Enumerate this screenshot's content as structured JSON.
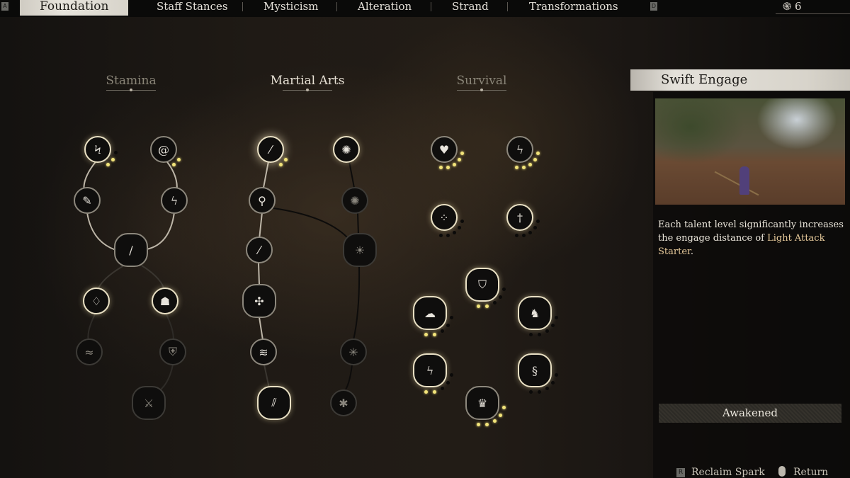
{
  "header": {
    "prev_key": "A",
    "next_key": "D",
    "tabs": [
      {
        "label": "Foundation",
        "active": true
      },
      {
        "label": "Staff Stances",
        "active": false
      },
      {
        "label": "Mysticism",
        "active": false
      },
      {
        "label": "Alteration",
        "active": false
      },
      {
        "label": "Strand",
        "active": false
      },
      {
        "label": "Transformations",
        "active": false
      }
    ],
    "sparks_icon": "spark-swirl-icon",
    "sparks_count": "6"
  },
  "columns": [
    {
      "title": "Stamina",
      "selected": false
    },
    {
      "title": "Martial Arts",
      "selected": true
    },
    {
      "title": "Survival",
      "selected": false
    }
  ],
  "nodes": {
    "stamina": [
      {
        "icon": "dash-icon",
        "glyph": "Ϟ",
        "state": "lit",
        "level": 2,
        "max": 3
      },
      {
        "icon": "swirl-icon",
        "glyph": "@",
        "state": "normal",
        "level": 2,
        "max": 2
      },
      {
        "icon": "scroll-icon",
        "glyph": "✎",
        "state": "normal"
      },
      {
        "icon": "wind-icon",
        "glyph": "ϟ",
        "state": "normal"
      },
      {
        "icon": "staff-swirl-icon",
        "glyph": "∕",
        "state": "normal",
        "major": true
      },
      {
        "icon": "droplet-icon",
        "glyph": "♢",
        "state": "lit"
      },
      {
        "icon": "guard-figure-icon",
        "glyph": "☗",
        "state": "lit"
      },
      {
        "icon": "dragon-icon",
        "glyph": "≈",
        "state": "dark"
      },
      {
        "icon": "shield-figure-icon",
        "glyph": "⛨",
        "state": "dark"
      },
      {
        "icon": "fighter-icon",
        "glyph": "⚔",
        "state": "dark",
        "major": true
      }
    ],
    "martial_arts": [
      {
        "icon": "staff-strike-icon",
        "glyph": "⁄",
        "state": "lit",
        "level": 2,
        "max": 2,
        "selected": true
      },
      {
        "icon": "burst-icon",
        "glyph": "✺",
        "state": "lit"
      },
      {
        "icon": "staff-spin-icon",
        "glyph": "⚲",
        "state": "normal"
      },
      {
        "icon": "burst-dim-icon",
        "glyph": "✺",
        "state": "dark"
      },
      {
        "icon": "thrust-icon",
        "glyph": "⁄",
        "state": "normal"
      },
      {
        "icon": "eye-sun-icon",
        "glyph": "☀",
        "state": "dark",
        "major": true
      },
      {
        "icon": "shuriken-icon",
        "glyph": "✣",
        "state": "normal",
        "major": true
      },
      {
        "icon": "claws-icon",
        "glyph": "≋",
        "state": "normal"
      },
      {
        "icon": "spark-dim-icon",
        "glyph": "✳",
        "state": "dark"
      },
      {
        "icon": "staves-icon",
        "glyph": "⫽",
        "state": "lit",
        "major": true
      },
      {
        "icon": "web-icon",
        "glyph": "✱",
        "state": "dark"
      }
    ],
    "survival": [
      {
        "icon": "heart-icon",
        "glyph": "♥",
        "state": "normal",
        "level": 5,
        "max": 5
      },
      {
        "icon": "lightning-icon",
        "glyph": "ϟ",
        "state": "normal",
        "level": 5,
        "max": 5
      },
      {
        "icon": "four-swirls-icon",
        "glyph": "⁘",
        "state": "lit",
        "level": 0,
        "max": 5
      },
      {
        "icon": "blade-icon",
        "glyph": "†",
        "state": "lit",
        "level": 0,
        "max": 5
      },
      {
        "icon": "shield-crest-icon",
        "glyph": "⛉",
        "state": "lit",
        "level": 2,
        "max": 5,
        "major": true
      },
      {
        "icon": "cloud-icon",
        "glyph": "☁",
        "state": "lit",
        "level": 2,
        "max": 5,
        "major": true
      },
      {
        "icon": "beast-icon",
        "glyph": "♞",
        "state": "lit",
        "level": 0,
        "max": 5,
        "major": true
      },
      {
        "icon": "lightning-rune-icon",
        "glyph": "ϟ",
        "state": "lit",
        "level": 2,
        "max": 5,
        "major": true
      },
      {
        "icon": "dragon-head-icon",
        "glyph": "§",
        "state": "lit",
        "level": 0,
        "max": 5,
        "major": true
      },
      {
        "icon": "crown-icon",
        "glyph": "♛",
        "state": "normal",
        "level": 5,
        "max": 5,
        "major": true
      }
    ]
  },
  "detail": {
    "title": "Swift Engage",
    "description_prefix": "Each talent level significantly increases the engage distance of ",
    "description_highlight": "Light Attack Starter",
    "description_suffix": ".",
    "status": "Awakened"
  },
  "footer": {
    "reclaim_key": "R",
    "reclaim_label": "Reclaim Spark",
    "return_icon": "mouse-icon",
    "return_label": "Return"
  },
  "colors": {
    "pip_on": "#f2e47a",
    "highlight": "#e6c99a",
    "active_tab_bg": "#e0ddd5"
  }
}
